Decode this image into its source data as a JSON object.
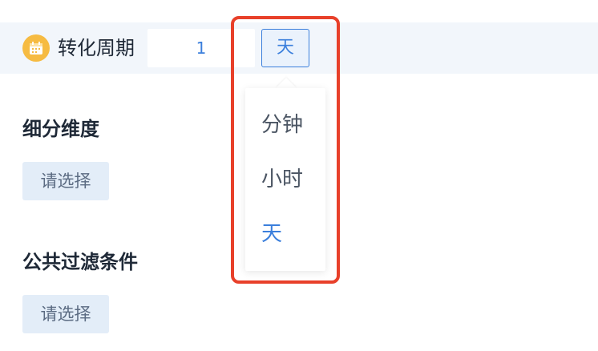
{
  "conversion_period": {
    "label": "转化周期",
    "value": "1",
    "unit_selected": "天",
    "unit_options": [
      "分钟",
      "小时",
      "天"
    ]
  },
  "segment_dimension": {
    "title": "细分维度",
    "select_label": "请选择"
  },
  "public_filter": {
    "title": "公共过滤条件",
    "select_label": "请选择"
  },
  "colors": {
    "accent": "#3b7fdc",
    "highlight": "#e8402a",
    "icon_bg": "#f6bb42",
    "bar_bg": "#f2f6fb"
  }
}
